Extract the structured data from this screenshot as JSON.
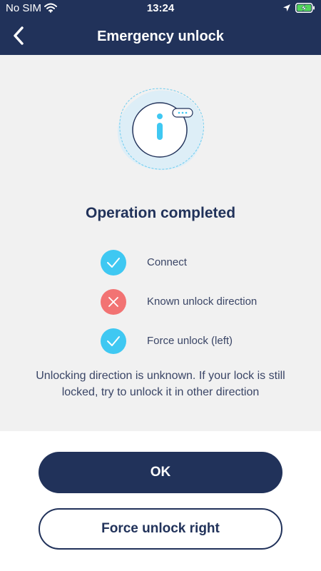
{
  "status_bar": {
    "carrier": "No SIM",
    "time": "13:24",
    "icons": [
      "wifi-icon",
      "location-icon",
      "battery-charging-icon"
    ]
  },
  "nav": {
    "title": "Emergency unlock",
    "back_icon": "chevron-left-icon"
  },
  "result": {
    "illustration_icon": "info-icon",
    "title": "Operation completed",
    "steps": [
      {
        "label": "Connect",
        "status": "success",
        "icon": "check-icon"
      },
      {
        "label": "Known unlock direction",
        "status": "failed",
        "icon": "x-icon"
      },
      {
        "label": "Force unlock (left)",
        "status": "success",
        "icon": "check-icon"
      }
    ],
    "message": "Unlocking direction is unknown. If your lock is still locked, try to unlock it in other direction"
  },
  "actions": {
    "ok_label": "OK",
    "force_unlock_right_label": "Force unlock right"
  },
  "colors": {
    "primary": "#21325a",
    "success": "#3fc8f2",
    "error": "#f27373",
    "background": "#f1f1f1",
    "battery": "#52d65a"
  }
}
